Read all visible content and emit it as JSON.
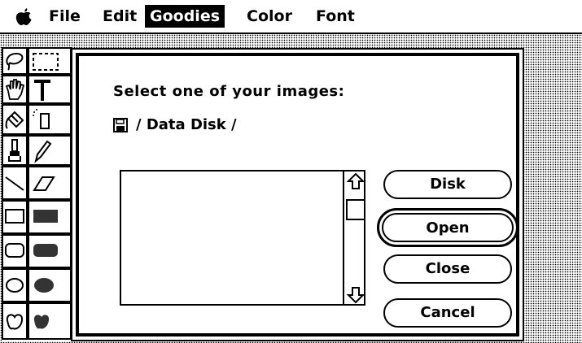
{
  "menubar": {
    "apple_icon": "apple-icon",
    "items": [
      "File",
      "Edit",
      "Goodies",
      "Color",
      "Font"
    ],
    "selected": "Goodies"
  },
  "dialog": {
    "prompt": "Select one of your images:",
    "disk_path": "/ Data Disk /",
    "disk_icon": "floppy-disk-icon",
    "file_list": [],
    "buttons": {
      "disk": "Disk",
      "open": "Open",
      "close": "Close",
      "cancel": "Cancel"
    },
    "default_button": "Open"
  },
  "palette": {
    "tools": [
      "lasso",
      "selection-rectangle",
      "grabber-hand",
      "text",
      "paint-bucket",
      "spray-can",
      "paintbrush",
      "pencil",
      "line",
      "eraser",
      "rectangle",
      "filled-rectangle",
      "rounded-rectangle",
      "filled-rounded-rectangle",
      "oval",
      "filled-oval",
      "freeform-shape",
      "filled-freeform-shape"
    ]
  }
}
